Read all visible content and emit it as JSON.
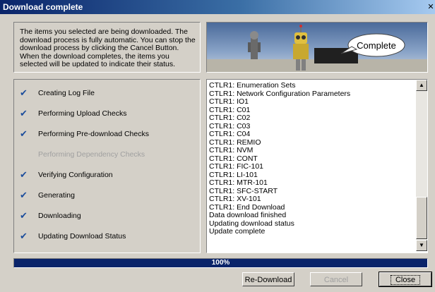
{
  "window": {
    "title": "Download complete"
  },
  "intro": {
    "text": "The items you selected are being downloaded.  The download process is fully automatic.  You can stop the download process by clicking the Cancel Button. When the download completes, the items you selected will be updated to indicate their status."
  },
  "banner": {
    "bubble_text": "Complete"
  },
  "steps": [
    {
      "label": "Creating Log File",
      "checked": true
    },
    {
      "label": "Performing Upload Checks",
      "checked": true
    },
    {
      "label": "Performing Pre-download Checks",
      "checked": true
    },
    {
      "label": "Performing Dependency Checks",
      "checked": false
    },
    {
      "label": "Verifying Configuration",
      "checked": true
    },
    {
      "label": "Generating",
      "checked": true
    },
    {
      "label": "Downloading",
      "checked": true
    },
    {
      "label": "Updating Download Status",
      "checked": true
    }
  ],
  "log": {
    "lines": [
      "CTLR1: Enumeration Sets",
      "CTLR1: Network Configuration Parameters",
      "CTLR1: IO1",
      "CTLR1: C01",
      "CTLR1: C02",
      "CTLR1: C03",
      "CTLR1: C04",
      "CTLR1: REMIO",
      "CTLR1: NVM",
      "CTLR1: CONT",
      "CTLR1: FIC-101",
      "CTLR1: LI-101",
      "CTLR1: MTR-101",
      "CTLR1: SFC-START",
      "CTLR1: XV-101",
      "CTLR1: End Download",
      "Data download finished",
      "Updating download status",
      "Update complete"
    ]
  },
  "progress": {
    "label": "100%",
    "fraction": 1.0
  },
  "buttons": {
    "redownload": "Re-Download",
    "cancel": "Cancel",
    "close": "Close"
  }
}
